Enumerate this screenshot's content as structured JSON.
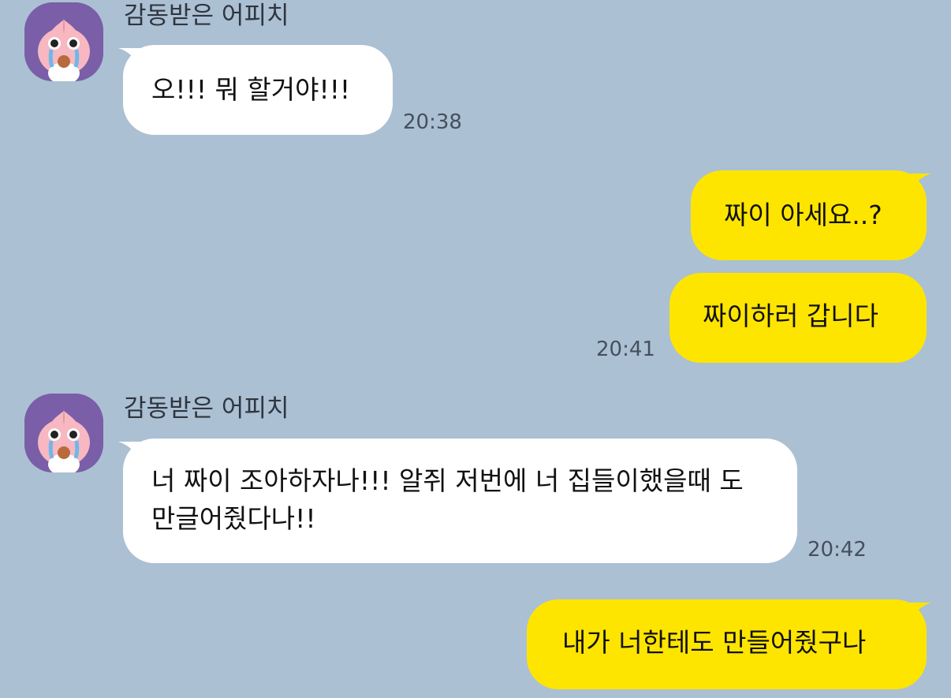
{
  "chat": {
    "colors": {
      "background": "#abc0d3",
      "incoming": "#ffffff",
      "outgoing": "#fee500",
      "avatar_bg": "#7a5ea8"
    },
    "groups": [
      {
        "sender": "감동받은 어피치",
        "avatar_icon": "apeach-crying-avatar-icon",
        "messages": [
          {
            "text": "오!!! 뭐 할거야!!!",
            "time": "20:38"
          }
        ]
      },
      {
        "sender": "me",
        "messages": [
          {
            "text": "짜이 아세요..?"
          },
          {
            "text": "짜이하러 갑니다",
            "time": "20:41"
          }
        ]
      },
      {
        "sender": "감동받은 어피치",
        "avatar_icon": "apeach-crying-avatar-icon",
        "messages": [
          {
            "text": "너 짜이 조아하자나!!! 알쥐 저번에 너 집들이했을때 도 만글어줬다나!!",
            "time": "20:42"
          }
        ]
      },
      {
        "sender": "me",
        "messages": [
          {
            "text": "내가 너한테도 만들어줬구나"
          }
        ]
      }
    ]
  }
}
